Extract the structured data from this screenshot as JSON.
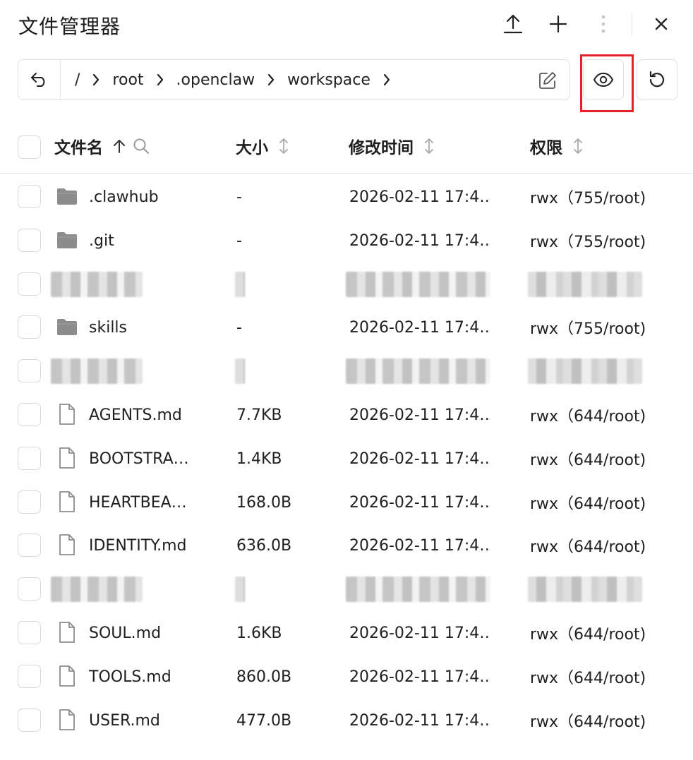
{
  "header": {
    "title": "文件管理器"
  },
  "path": {
    "segments": [
      "/",
      "root",
      ".openclaw",
      "workspace"
    ]
  },
  "columns": {
    "name": "文件名",
    "size": "大小",
    "time": "修改时间",
    "perm": "权限"
  },
  "rows": [
    {
      "type": "folder",
      "name": ".clawhub",
      "size": "-",
      "time": "2026-02-11 17:4…",
      "perm": "rwx（755/root)"
    },
    {
      "type": "folder",
      "name": ".git",
      "size": "-",
      "time": "2026-02-11 17:4…",
      "perm": "rwx（755/root)"
    },
    {
      "type": "redacted"
    },
    {
      "type": "folder",
      "name": "skills",
      "size": "-",
      "time": "2026-02-11 17:4…",
      "perm": "rwx（755/root)"
    },
    {
      "type": "redacted"
    },
    {
      "type": "file",
      "name": "AGENTS.md",
      "size": "7.7KB",
      "time": "2026-02-11 17:4…",
      "perm": "rwx（644/root)"
    },
    {
      "type": "file",
      "name": "BOOTSTRA…",
      "size": "1.4KB",
      "time": "2026-02-11 17:4…",
      "perm": "rwx（644/root)"
    },
    {
      "type": "file",
      "name": "HEARTBEA…",
      "size": "168.0B",
      "time": "2026-02-11 17:4…",
      "perm": "rwx（644/root)"
    },
    {
      "type": "file",
      "name": "IDENTITY.md",
      "size": "636.0B",
      "time": "2026-02-11 17:4…",
      "perm": "rwx（644/root)"
    },
    {
      "type": "redacted"
    },
    {
      "type": "file",
      "name": "SOUL.md",
      "size": "1.6KB",
      "time": "2026-02-11 17:4…",
      "perm": "rwx（644/root)"
    },
    {
      "type": "file",
      "name": "TOOLS.md",
      "size": "860.0B",
      "time": "2026-02-11 17:4…",
      "perm": "rwx（644/root)"
    },
    {
      "type": "file",
      "name": "USER.md",
      "size": "477.0B",
      "time": "2026-02-11 17:4…",
      "perm": "rwx（644/root)"
    }
  ],
  "icons": {
    "upload": "upload-icon",
    "add": "plus-icon",
    "more": "more-vertical-icon",
    "close": "close-icon",
    "back": "undo-arrow-icon",
    "edit": "edit-icon",
    "view": "eye-icon",
    "refresh": "refresh-icon",
    "folder": "folder-icon",
    "file": "file-icon"
  },
  "colors": {
    "highlight": "#e8202a",
    "folder": "#8c8c8c",
    "border": "#dcdfe6"
  }
}
